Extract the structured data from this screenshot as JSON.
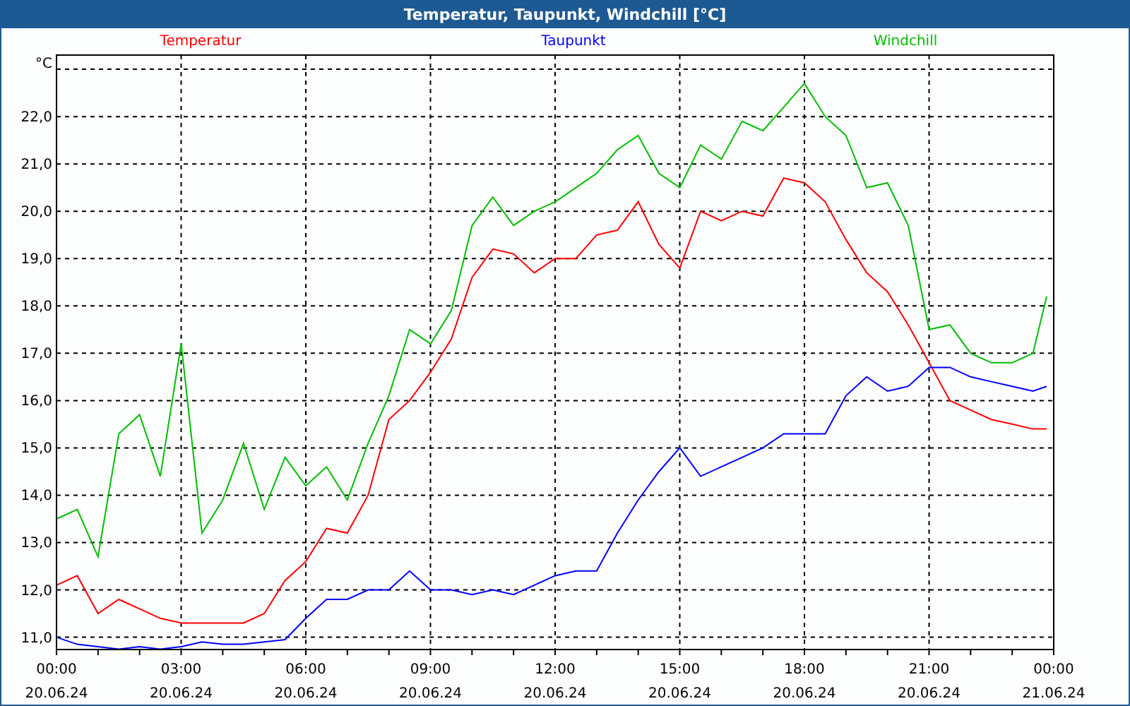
{
  "window": {
    "title": "Temperatur, Taupunkt, Windchill [°C]"
  },
  "chart": {
    "unit_label": "°C",
    "x_date_labels": [
      "20.06.24",
      "20.06.24",
      "20.06.24",
      "20.06.24",
      "20.06.24",
      "20.06.24",
      "20.06.24",
      "20.06.24",
      "21.06.24"
    ],
    "chart_data": {
      "type": "line",
      "grid": true,
      "x": [
        0,
        0.5,
        1,
        1.5,
        2,
        2.5,
        3,
        3.5,
        4,
        4.5,
        5,
        5.5,
        6,
        6.5,
        7,
        7.5,
        8,
        8.5,
        9,
        9.5,
        10,
        10.5,
        11,
        11.5,
        12,
        12.5,
        13,
        13.5,
        14,
        14.5,
        15,
        15.5,
        16,
        16.5,
        17,
        17.5,
        18,
        18.5,
        19,
        19.5,
        20,
        20.5,
        21,
        21.5,
        22,
        22.5,
        23,
        23.5,
        23.83
      ],
      "series": [
        {
          "name": "Temperatur",
          "color": "#ff0000",
          "values": [
            12.1,
            12.3,
            11.5,
            11.8,
            11.6,
            11.4,
            11.3,
            11.3,
            11.3,
            11.3,
            11.5,
            12.2,
            12.6,
            13.3,
            13.2,
            14.0,
            15.6,
            16.0,
            16.6,
            17.3,
            18.6,
            19.2,
            19.1,
            18.7,
            19.0,
            19.0,
            19.5,
            19.6,
            20.2,
            19.3,
            18.8,
            20.0,
            19.8,
            20.0,
            19.9,
            20.7,
            20.6,
            20.2,
            19.4,
            18.7,
            18.3,
            17.6,
            16.8,
            16.0,
            15.8,
            15.6,
            15.5,
            15.4,
            15.4
          ]
        },
        {
          "name": "Taupunkt",
          "color": "#0000ff",
          "values": [
            11.0,
            10.85,
            10.8,
            10.75,
            10.8,
            10.75,
            10.8,
            10.9,
            10.85,
            10.85,
            10.9,
            10.95,
            11.4,
            11.8,
            11.8,
            12.0,
            12.0,
            12.4,
            12.0,
            12.0,
            11.9,
            12.0,
            11.9,
            12.1,
            12.3,
            12.4,
            12.4,
            13.2,
            13.9,
            14.5,
            15.0,
            14.4,
            14.6,
            14.8,
            15.0,
            15.3,
            15.3,
            15.3,
            16.1,
            16.5,
            16.2,
            16.3,
            16.7,
            16.7,
            16.5,
            16.4,
            16.3,
            16.2,
            16.3
          ]
        },
        {
          "name": "Windchill",
          "color": "#00c000",
          "values": [
            13.5,
            13.7,
            12.7,
            15.3,
            15.7,
            14.4,
            17.2,
            13.2,
            13.9,
            15.1,
            13.7,
            14.8,
            14.2,
            14.6,
            13.9,
            15.1,
            16.1,
            17.5,
            17.2,
            17.9,
            19.7,
            20.3,
            19.7,
            20.0,
            20.2,
            20.5,
            20.8,
            21.3,
            21.6,
            20.8,
            20.5,
            21.4,
            21.1,
            21.9,
            21.7,
            22.2,
            22.7,
            22.0,
            21.6,
            20.5,
            20.6,
            19.7,
            17.5,
            17.6,
            17.0,
            16.8,
            16.8,
            17.0,
            18.2
          ]
        }
      ],
      "xlim": [
        0,
        24
      ],
      "ylim": [
        10.74,
        23.3
      ],
      "xticks": [
        {
          "value": 0,
          "label": "00:00"
        },
        {
          "value": 3,
          "label": "03:00"
        },
        {
          "value": 6,
          "label": "06:00"
        },
        {
          "value": 9,
          "label": "09:00"
        },
        {
          "value": 12,
          "label": "12:00"
        },
        {
          "value": 15,
          "label": "15:00"
        },
        {
          "value": 18,
          "label": "18:00"
        },
        {
          "value": 21,
          "label": "21:00"
        },
        {
          "value": 24,
          "label": "00:00"
        }
      ],
      "yticks": [
        {
          "value": 11,
          "label": "11,0"
        },
        {
          "value": 12,
          "label": "12,0"
        },
        {
          "value": 13,
          "label": "13,0"
        },
        {
          "value": 14,
          "label": "14,0"
        },
        {
          "value": 15,
          "label": "15,0"
        },
        {
          "value": 16,
          "label": "16,0"
        },
        {
          "value": 17,
          "label": "17,0"
        },
        {
          "value": 18,
          "label": "18,0"
        },
        {
          "value": 19,
          "label": "19,0"
        },
        {
          "value": 20,
          "label": "20,0"
        },
        {
          "value": 21,
          "label": "21,0"
        },
        {
          "value": 22,
          "label": "22,0"
        }
      ]
    }
  }
}
